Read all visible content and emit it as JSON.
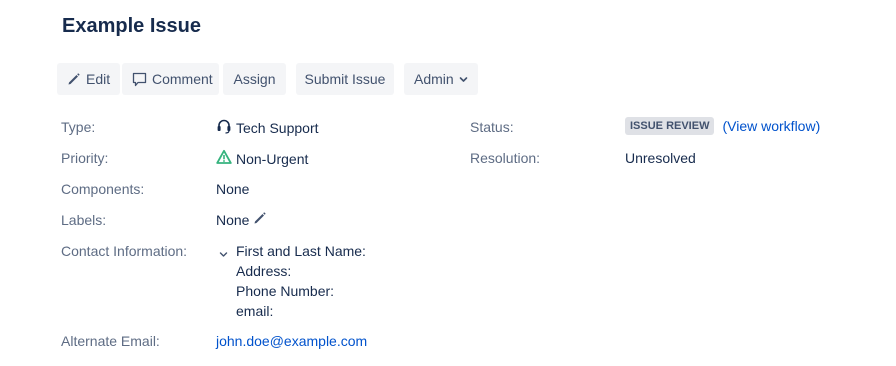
{
  "issue": {
    "title": "Example Issue"
  },
  "toolbar": {
    "edit_label": "Edit",
    "comment_label": "Comment",
    "assign_label": "Assign",
    "submit_label": "Submit Issue",
    "admin_label": "Admin"
  },
  "details": {
    "type": {
      "label": "Type:",
      "value": "Tech Support",
      "icon": "headset-icon"
    },
    "priority": {
      "label": "Priority:",
      "value": "Non-Urgent",
      "icon": "priority-warning-icon",
      "color": "#36b37e"
    },
    "components": {
      "label": "Components:",
      "value": "None"
    },
    "labels": {
      "label": "Labels:",
      "value": "None"
    },
    "contact": {
      "label": "Contact Information:",
      "lines": [
        "First and Last Name:",
        "Address:",
        "Phone Number:",
        "email:"
      ]
    },
    "alternate_email": {
      "label": "Alternate Email:",
      "value": "john.doe@example.com"
    },
    "status": {
      "label": "Status:",
      "value": "ISSUE REVIEW",
      "workflow_open": "(",
      "workflow_link": "View workflow",
      "workflow_close": ")"
    },
    "resolution": {
      "label": "Resolution:",
      "value": "Unresolved"
    }
  },
  "colors": {
    "accent": "#0052cc",
    "text": "#172b4d",
    "muted": "#5e6c84",
    "button_bg": "#f4f5f7"
  }
}
